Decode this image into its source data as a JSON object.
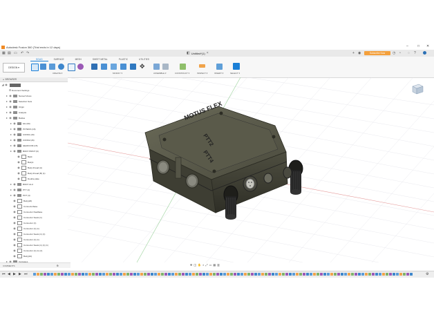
{
  "window": {
    "title": "Autodesk Fusion 360 (Trial ends in 12 days)",
    "controls": [
      "–",
      "□",
      "✕"
    ]
  },
  "document": {
    "tab_title": "Untitled*(1)",
    "trial_button": "Subscribe Now"
  },
  "toolbar": {
    "workspace": "DESIGN ▾",
    "tabs": [
      "SOLID",
      "SURFACE",
      "MESH",
      "SHEET METAL",
      "PLASTIC",
      "UTILITIES"
    ],
    "active_tab": "SOLID",
    "groups": [
      "CREATE ▾",
      "MODIFY ▾",
      "ASSEMBLE ▾",
      "CONSTRUCT ▾",
      "INSPECT ▾",
      "INSERT ▾",
      "SELECT ▾"
    ]
  },
  "browser": {
    "header": "BROWSER",
    "root": "Untitled",
    "items": [
      {
        "label": "Document Settings",
        "indent": 1,
        "kind": "gear"
      },
      {
        "label": "Named Views",
        "indent": 1,
        "kind": "folder"
      },
      {
        "label": "Selection Sets",
        "indent": 1,
        "kind": "folder"
      },
      {
        "label": "Origin",
        "indent": 1,
        "kind": "folder"
      },
      {
        "label": "Analysis",
        "indent": 1,
        "kind": "folder"
      },
      {
        "label": "Bodies",
        "indent": 1,
        "kind": "folder"
      },
      {
        "label": "lids (60)",
        "indent": 2,
        "kind": "folder"
      },
      {
        "label": "POTENS (16)",
        "indent": 2,
        "kind": "folder"
      },
      {
        "label": "CONN1 (20)",
        "indent": 2,
        "kind": "folder"
      },
      {
        "label": "CONN2 (26)",
        "indent": 2,
        "kind": "folder"
      },
      {
        "label": "HEADCOM (15)",
        "indent": 2,
        "kind": "folder"
      },
      {
        "label": "BODY PRINT (9)",
        "indent": 2,
        "kind": "folder"
      },
      {
        "label": "Back",
        "indent": 3,
        "kind": "body"
      },
      {
        "label": "Body1",
        "indent": 3,
        "kind": "body"
      },
      {
        "label": "Body thread (A)",
        "indent": 3,
        "kind": "body"
      },
      {
        "label": "Body thread (B) (1)",
        "indent": 3,
        "kind": "body"
      },
      {
        "label": "Double plate",
        "indent": 3,
        "kind": "body"
      },
      {
        "label": "BODY ALU",
        "indent": 2,
        "kind": "folder"
      },
      {
        "label": "PT7 (4)",
        "indent": 2,
        "kind": "folder"
      },
      {
        "label": "POT (4)",
        "indent": 2,
        "kind": "folder"
      },
      {
        "label": "Body(20)",
        "indent": 2,
        "kind": "body"
      },
      {
        "label": "Connectorbase",
        "indent": 2,
        "kind": "body"
      },
      {
        "label": "Connector Dealbase",
        "indent": 2,
        "kind": "body"
      },
      {
        "label": "Connector Seats (1)",
        "indent": 2,
        "kind": "body"
      },
      {
        "label": "Connector (1)",
        "indent": 2,
        "kind": "body"
      },
      {
        "label": "Connector (1) (1)",
        "indent": 2,
        "kind": "body"
      },
      {
        "label": "Connector Seats (1) (1)",
        "indent": 2,
        "kind": "body"
      },
      {
        "label": "Connector (1) (1)",
        "indent": 2,
        "kind": "body"
      },
      {
        "label": "Connector Seats (1) (1) (1)",
        "indent": 2,
        "kind": "body"
      },
      {
        "label": "Connector (1) (1) (1)",
        "indent": 2,
        "kind": "body"
      },
      {
        "label": "Body(10)",
        "indent": 2,
        "kind": "body"
      },
      {
        "label": "Canvases",
        "indent": 1,
        "kind": "folder"
      }
    ]
  },
  "model_text": {
    "top_label": "MOTUS FLEX",
    "side_label_1": "PTT2",
    "side_label_2": "PTT4"
  },
  "comments": {
    "label": "COMMENTS"
  },
  "colors": {
    "accent": "#1b7fd6",
    "trial": "#f4a03c",
    "model": "#4a4a3c"
  }
}
